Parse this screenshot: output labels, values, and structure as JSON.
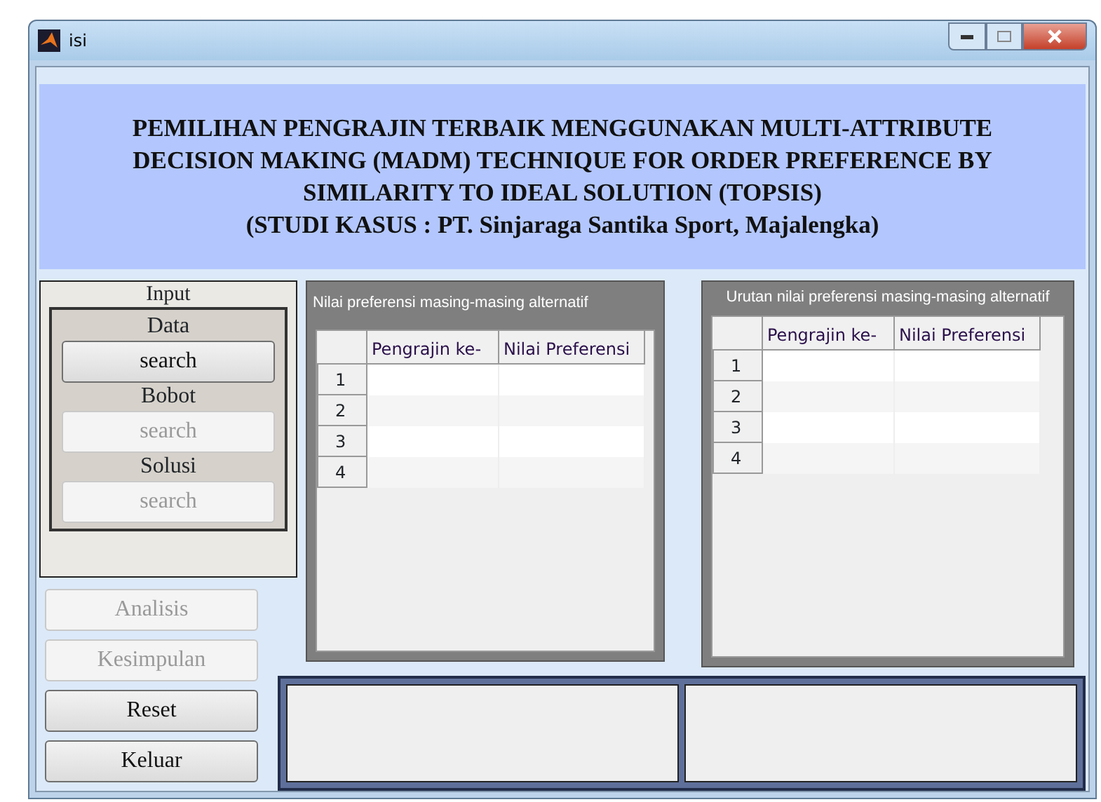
{
  "window": {
    "title": "isi"
  },
  "header": {
    "lines": [
      "PEMILIHAN PENGRAJIN TERBAIK MENGGUNAKAN MULTI-ATTRIBUTE",
      "DECISION MAKING (MADM) TECHNIQUE FOR ORDER PREFERENCE BY",
      "SIMILARITY TO IDEAL SOLUTION (TOPSIS)",
      "(STUDI KASUS : PT. Sinjaraga Santika Sport, Majalengka)"
    ]
  },
  "input_panel": {
    "title": "Input",
    "groups": [
      {
        "label": "Data",
        "button": {
          "label": "search",
          "disabled": false
        }
      },
      {
        "label": "Bobot",
        "button": {
          "label": "search",
          "disabled": true
        }
      },
      {
        "label": "Solusi",
        "button": {
          "label": "search",
          "disabled": true
        }
      }
    ]
  },
  "actions": [
    {
      "label": "Analisis",
      "disabled": true
    },
    {
      "label": "Kesimpulan",
      "disabled": true
    },
    {
      "label": "Reset",
      "disabled": false
    },
    {
      "label": "Keluar",
      "disabled": false
    }
  ],
  "tables": [
    {
      "title": "Nilai preferensi masing-masing alternatif",
      "columns": [
        "Pengrajin ke-",
        "Nilai Preferensi"
      ],
      "rows": [
        "1",
        "2",
        "3",
        "4"
      ]
    },
    {
      "title": "Urutan nilai preferensi masing-masing alternatif",
      "columns": [
        "Pengrajin ke-",
        "Nilai Preferensi"
      ],
      "rows": [
        "1",
        "2",
        "3",
        "4"
      ]
    }
  ]
}
